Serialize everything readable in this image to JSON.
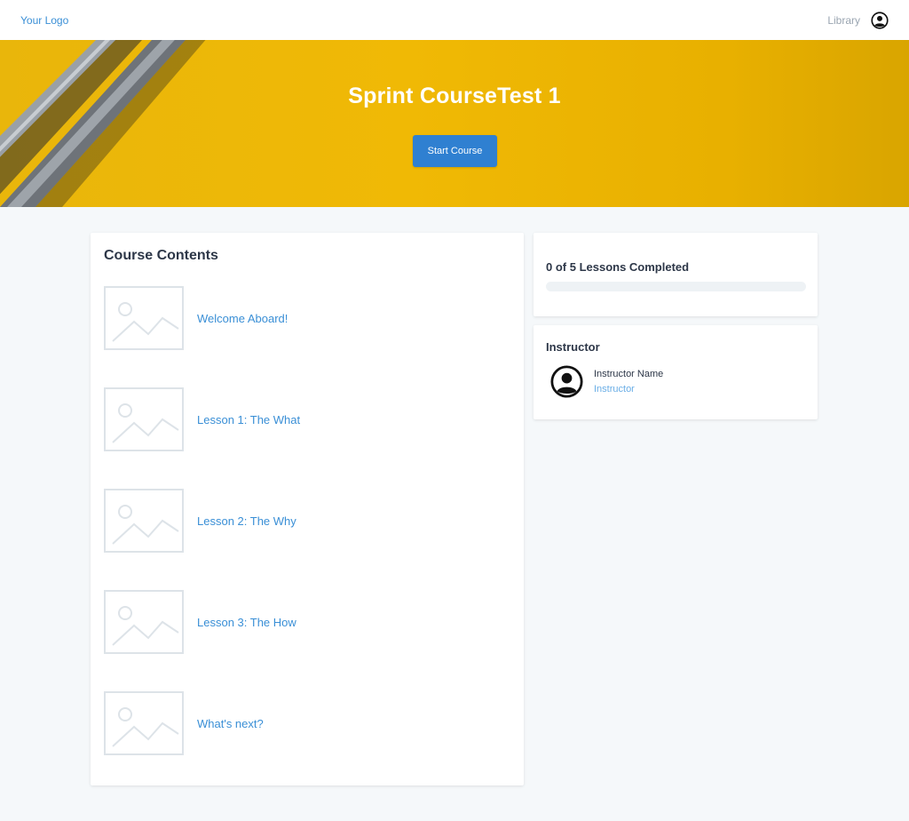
{
  "header": {
    "logo": "Your Logo",
    "nav_library": "Library",
    "account_icon": "user-circle-icon"
  },
  "hero": {
    "title": "Sprint CourseTest 1",
    "button_label": "Start Course",
    "background_color": "#f0b905"
  },
  "course_contents": {
    "title": "Course Contents",
    "lessons": [
      {
        "title": "Welcome Aboard!",
        "thumbnail_icon": "image-placeholder-icon"
      },
      {
        "title": "Lesson 1: The What",
        "thumbnail_icon": "image-placeholder-icon"
      },
      {
        "title": "Lesson 2: The Why",
        "thumbnail_icon": "image-placeholder-icon"
      },
      {
        "title": "Lesson 3: The How",
        "thumbnail_icon": "image-placeholder-icon"
      },
      {
        "title": "What's next?",
        "thumbnail_icon": "image-placeholder-icon"
      }
    ]
  },
  "progress": {
    "label": "0 of 5 Lessons Completed",
    "completed": 0,
    "total": 5
  },
  "instructor": {
    "heading": "Instructor",
    "name": "Instructor Name",
    "role": "Instructor",
    "avatar_icon": "user-circle-icon"
  },
  "colors": {
    "accent": "#2f80d1",
    "link": "#3a8fd6",
    "page_background": "#f5f8fa"
  }
}
